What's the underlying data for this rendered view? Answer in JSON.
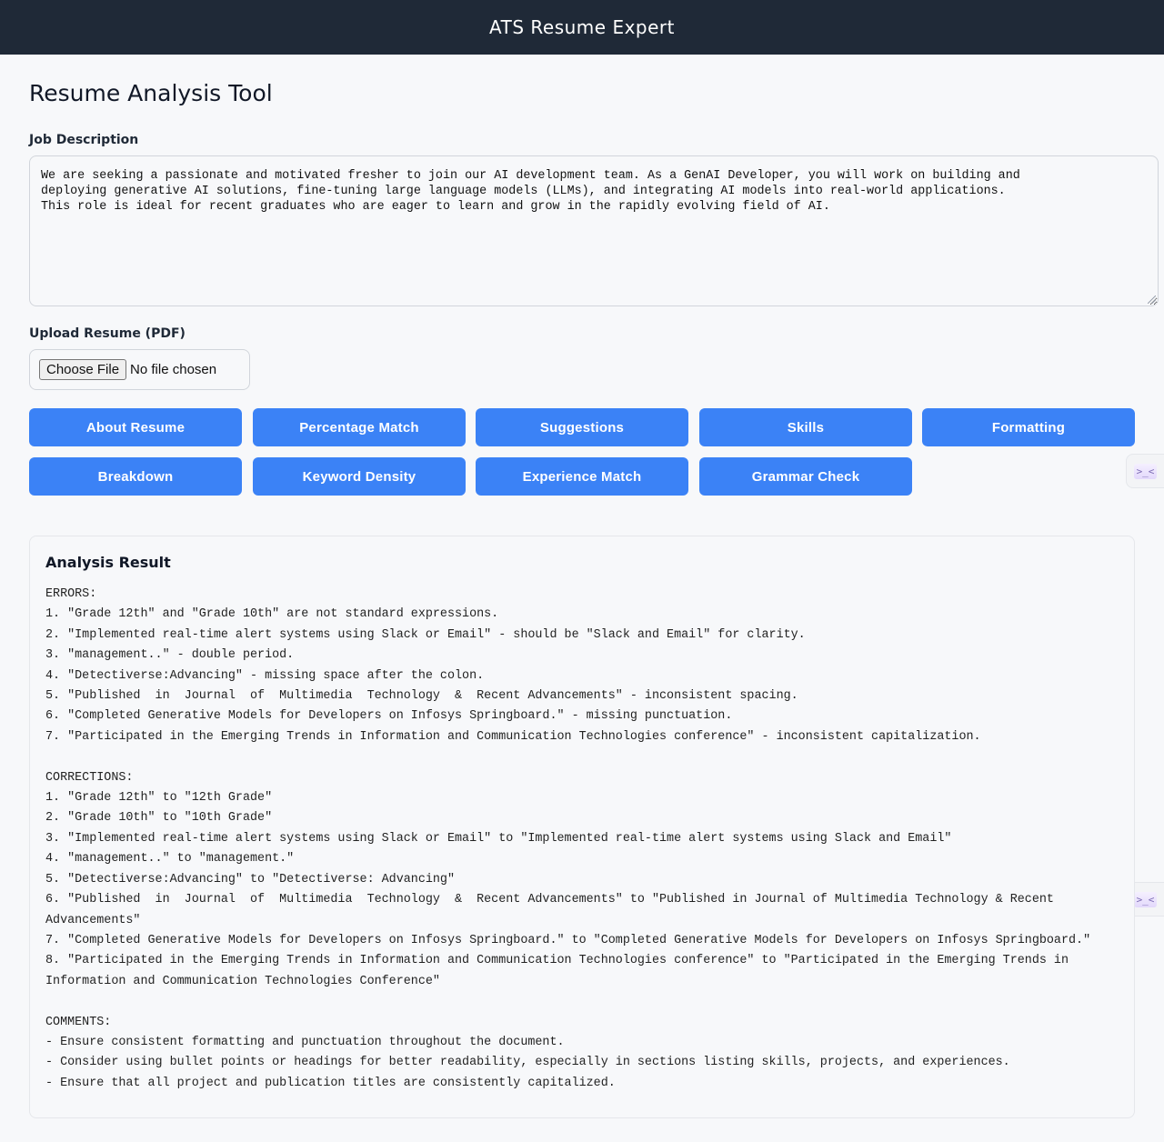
{
  "header": {
    "title": "ATS Resume Expert"
  },
  "main": {
    "title": "Resume Analysis Tool",
    "job_description": {
      "label": "Job Description",
      "value": "We are seeking a passionate and motivated fresher to join our AI development team. As a GenAI Developer, you will work on building and\ndeploying generative AI solutions, fine-tuning large language models (LLMs), and integrating AI models into real-world applications.\nThis role is ideal for recent graduates who are eager to learn and grow in the rapidly evolving field of AI."
    },
    "upload": {
      "label": "Upload Resume (PDF)",
      "button": "Choose File",
      "status": "No file chosen"
    },
    "buttons": [
      "About Resume",
      "Percentage Match",
      "Suggestions",
      "Skills",
      "Formatting",
      "Breakdown",
      "Keyword Density",
      "Experience Match",
      "Grammar Check"
    ],
    "result": {
      "title": "Analysis Result",
      "text": "ERRORS:\n1. \"Grade 12th\" and \"Grade 10th\" are not standard expressions.\n2. \"Implemented real-time alert systems using Slack or Email\" - should be \"Slack and Email\" for clarity.\n3. \"management..\" - double period.\n4. \"Detectiverse:Advancing\" - missing space after the colon.\n5. \"Published  in  Journal  of  Multimedia  Technology  &  Recent Advancements\" - inconsistent spacing.\n6. \"Completed Generative Models for Developers on Infosys Springboard.\" - missing punctuation.\n7. \"Participated in the Emerging Trends in Information and Communication Technologies conference\" - inconsistent capitalization.\n\nCORRECTIONS:\n1. \"Grade 12th\" to \"12th Grade\"\n2. \"Grade 10th\" to \"10th Grade\"\n3. \"Implemented real-time alert systems using Slack or Email\" to \"Implemented real-time alert systems using Slack and Email\"\n4. \"management..\" to \"management.\"\n5. \"Detectiverse:Advancing\" to \"Detectiverse: Advancing\"\n6. \"Published  in  Journal  of  Multimedia  Technology  &  Recent Advancements\" to \"Published in Journal of Multimedia Technology & Recent\nAdvancements\"\n7. \"Completed Generative Models for Developers on Infosys Springboard.\" to \"Completed Generative Models for Developers on Infosys Springboard.\"\n8. \"Participated in the Emerging Trends in Information and Communication Technologies conference\" to \"Participated in the Emerging Trends in\nInformation and Communication Technologies Conference\"\n\nCOMMENTS:\n- Ensure consistent formatting and punctuation throughout the document.\n- Consider using bullet points or headings for better readability, especially in sections listing skills, projects, and experiences.\n- Ensure that all project and publication titles are consistently capitalized."
    }
  },
  "side_widget": {
    "icon": "terminal-icon",
    "glyph": ">_<"
  },
  "colors": {
    "header_bg": "#1f2937",
    "accent": "#3b82f6"
  }
}
